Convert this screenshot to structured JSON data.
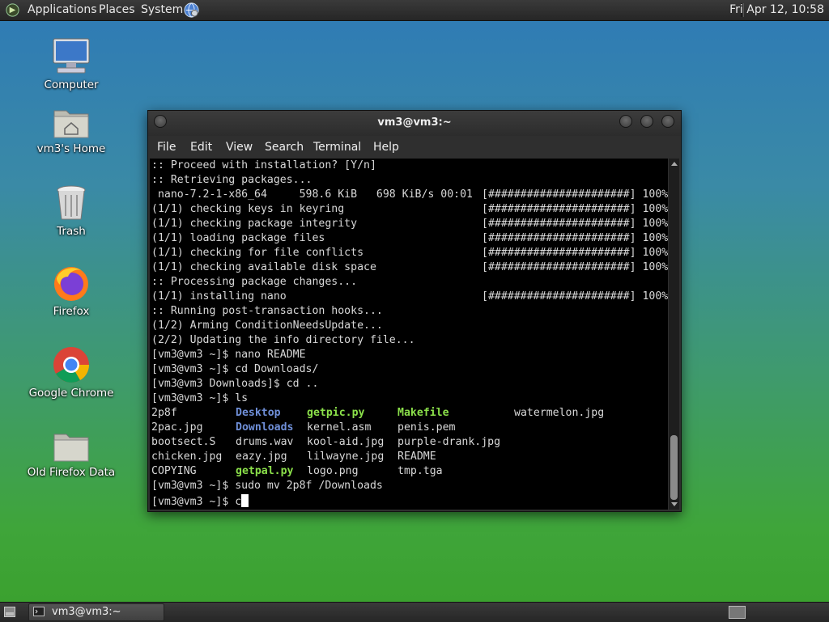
{
  "top_panel": {
    "menus": [
      "Applications",
      "Places",
      "System"
    ],
    "clock": "Fri Apr 12, 10:58"
  },
  "desktop_icons": [
    {
      "label": "Computer",
      "icon": "computer-icon"
    },
    {
      "label": "vm3's Home",
      "icon": "home-folder-icon"
    },
    {
      "label": "Trash",
      "icon": "trash-icon"
    },
    {
      "label": "Firefox",
      "icon": "firefox-icon"
    },
    {
      "label": "Google Chrome",
      "icon": "chrome-icon"
    },
    {
      "label": "Old Firefox Data",
      "icon": "folder-icon"
    }
  ],
  "window": {
    "title": "vm3@vm3:~",
    "menu": [
      "File",
      "Edit",
      "View",
      "Search",
      "Terminal",
      "Help"
    ]
  },
  "terminal": {
    "lines": [
      {
        "l": ":: Proceed with installation? [Y/n]",
        "r": ""
      },
      {
        "l": ":: Retrieving packages...",
        "r": ""
      },
      {
        "l": " nano-7.2-1-x86_64     598.6 KiB   698 KiB/s 00:01",
        "r": "[######################] 100%"
      },
      {
        "l": "(1/1) checking keys in keyring",
        "r": "[######################] 100%"
      },
      {
        "l": "(1/1) checking package integrity",
        "r": "[######################] 100%"
      },
      {
        "l": "(1/1) loading package files",
        "r": "[######################] 100%"
      },
      {
        "l": "(1/1) checking for file conflicts",
        "r": "[######################] 100%"
      },
      {
        "l": "(1/1) checking available disk space",
        "r": "[######################] 100%"
      },
      {
        "l": ":: Processing package changes...",
        "r": ""
      },
      {
        "l": "(1/1) installing nano",
        "r": "[######################] 100%"
      },
      {
        "l": ":: Running post-transaction hooks...",
        "r": ""
      },
      {
        "l": "(1/2) Arming ConditionNeedsUpdate...",
        "r": ""
      },
      {
        "l": "(2/2) Updating the info directory file...",
        "r": ""
      },
      {
        "l": "[vm3@vm3 ~]$ nano README",
        "r": ""
      },
      {
        "l": "[vm3@vm3 ~]$ cd Downloads/",
        "r": ""
      },
      {
        "l": "[vm3@vm3 Downloads]$ cd ..",
        "r": ""
      },
      {
        "l": "[vm3@vm3 ~]$ ls",
        "r": ""
      }
    ],
    "ls_rows": [
      [
        {
          "t": "2p8f",
          "k": ""
        },
        {
          "t": "Desktop",
          "k": "dir"
        },
        {
          "t": "getpic.py",
          "k": "exe"
        },
        {
          "t": "Makefile",
          "k": "exe"
        },
        {
          "t": "watermelon.jpg",
          "k": ""
        }
      ],
      [
        {
          "t": "2pac.jpg",
          "k": ""
        },
        {
          "t": "Downloads",
          "k": "dir"
        },
        {
          "t": "kernel.asm",
          "k": ""
        },
        {
          "t": "penis.pem",
          "k": ""
        },
        {
          "t": "",
          "k": ""
        }
      ],
      [
        {
          "t": "bootsect.S",
          "k": ""
        },
        {
          "t": "drums.wav",
          "k": ""
        },
        {
          "t": "kool-aid.jpg",
          "k": ""
        },
        {
          "t": "purple-drank.jpg",
          "k": ""
        },
        {
          "t": "",
          "k": ""
        }
      ],
      [
        {
          "t": "chicken.jpg",
          "k": ""
        },
        {
          "t": "eazy.jpg",
          "k": ""
        },
        {
          "t": "lilwayne.jpg",
          "k": ""
        },
        {
          "t": "README",
          "k": ""
        },
        {
          "t": "",
          "k": ""
        }
      ],
      [
        {
          "t": "COPYING",
          "k": ""
        },
        {
          "t": "getpal.py",
          "k": "exe"
        },
        {
          "t": "logo.png",
          "k": ""
        },
        {
          "t": "tmp.tga",
          "k": ""
        },
        {
          "t": "",
          "k": ""
        }
      ]
    ],
    "after_lines": [
      "[vm3@vm3 ~]$ sudo mv 2p8f /Downloads"
    ],
    "prompt": "[vm3@vm3 ~]$ ",
    "current_input": "c"
  },
  "taskbar": {
    "task_label": "vm3@vm3:~"
  },
  "colors": {
    "dir": "#6f8fd8",
    "exe": "#8be04a"
  }
}
